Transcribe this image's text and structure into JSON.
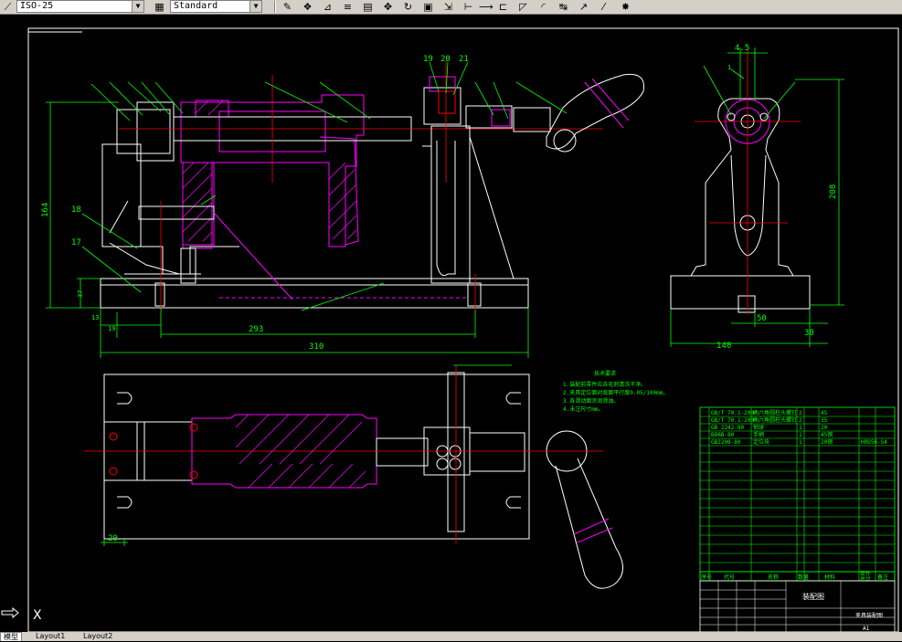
{
  "toolbar": {
    "dimstyle_value": "ISO-25",
    "textstyle_value": "Standard"
  },
  "drawing": {
    "front_view_labels": {
      "part_numbers_top": [
        "19",
        "20",
        "21"
      ],
      "part_numbers_left": [
        "18",
        "17"
      ],
      "dim_overall": "310",
      "dim_inner": "293",
      "dim_height": "164",
      "dim_left_a": "13",
      "dim_left_b": "19",
      "dim_base": "37"
    },
    "side_view_labels": {
      "dim_top": "4.5",
      "dim_height": "208",
      "dim_width": "140",
      "dim_inner": "50",
      "dim_right": "30",
      "dim_left_small": "1"
    },
    "plan_view_labels": {
      "dim_bottom": "20"
    },
    "tech_notes": [
      "技术要求",
      "1.装配前零件应去毛刺清洗干净。",
      "2.夹具定位面对底面平行度0.05/100mm。",
      "3.各滑动面涂润滑油。",
      "4.未注尺寸mm。"
    ],
    "bom_rows": [
      {
        "code": "GB/T 70.1-2000",
        "name": "内六角圆柱头螺钉",
        "qty": "2",
        "mat": "45"
      },
      {
        "code": "GB/T 70.1-2000",
        "name": "内六角圆柱头螺钉",
        "qty": "2",
        "mat": "35"
      },
      {
        "code": "GB 2242-80",
        "name": "钢球",
        "qty": "1",
        "mat": "20"
      },
      {
        "code": "B86B-80",
        "name": "手柄",
        "qty": "1",
        "mat": "45钢"
      },
      {
        "code": "GB2208-80",
        "name": "定位块",
        "qty": "1",
        "mat": "20钢"
      }
    ],
    "bom_header": [
      "序号",
      "代号",
      "名称",
      "数量",
      "材料",
      "单件",
      "总计",
      "备注"
    ],
    "title_block": {
      "title": "装配图",
      "subtitle": "夹具装配图",
      "drawing_number": "HRD56-S4",
      "scale": "A1"
    }
  },
  "tabs": [
    "模型",
    "Layout1",
    "Layout2"
  ],
  "colors": {
    "bg": "#000000",
    "geometry": "#ffffff",
    "dims": "#00ff00",
    "hatch": "#ff00ff",
    "center": "#ff0000",
    "bom": "#00ff00"
  }
}
